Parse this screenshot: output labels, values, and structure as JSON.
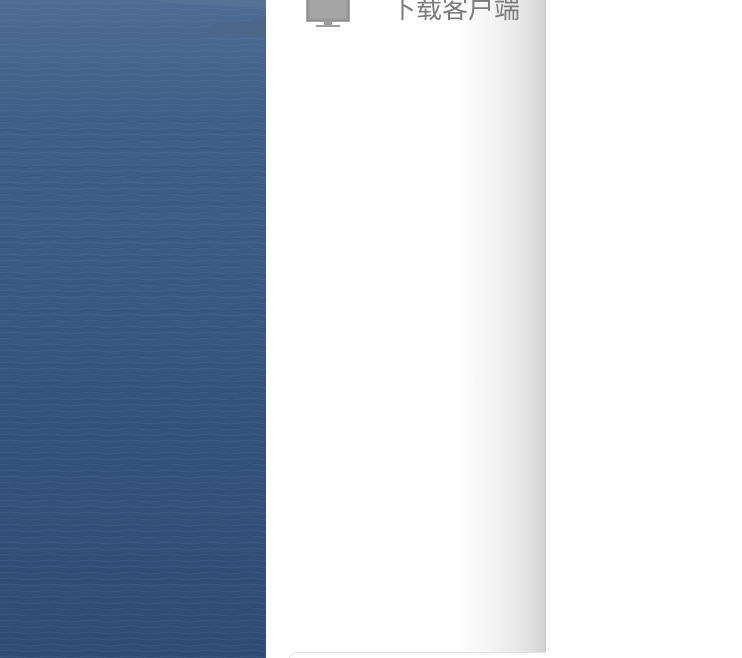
{
  "drawer": {
    "menu_items": [
      {
        "label": "下载客户端",
        "icon": "monitor-icon"
      }
    ]
  },
  "background": {
    "description_icon": "ocean-photo",
    "colors": {
      "sea_light": "#4e6c92",
      "sea_dark": "#2f4c74"
    }
  },
  "colors": {
    "drawer_bg": "#ffffff",
    "label_text": "#7c7c7c",
    "icon_fill": "#9e9e9e"
  }
}
